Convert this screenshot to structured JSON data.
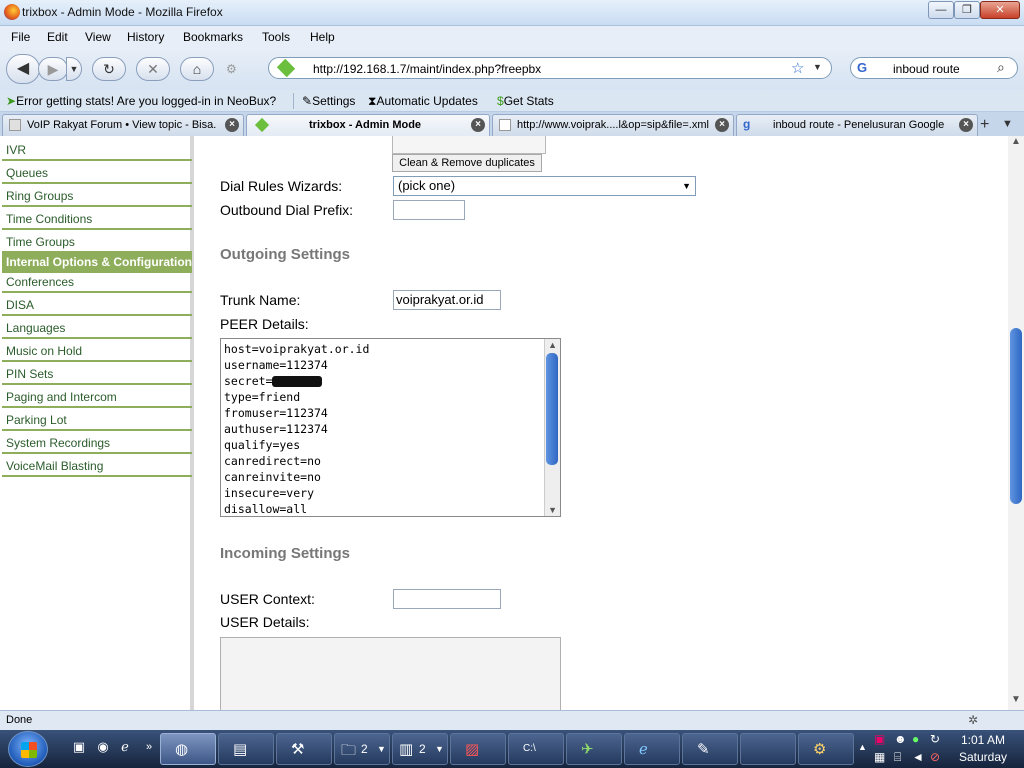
{
  "window": {
    "title": "trixbox - Admin Mode - Mozilla Firefox",
    "min": "—",
    "max": "❐",
    "close": "✕"
  },
  "menu": [
    "File",
    "Edit",
    "View",
    "History",
    "Bookmarks",
    "Tools",
    "Help"
  ],
  "nav": {
    "url": "http://192.168.1.7/maint/index.php?freepbx",
    "search_value": "inboud route"
  },
  "bookmarks": [
    "Error getting stats! Are you logged-in in NeoBux?",
    "Settings",
    "Automatic Updates",
    "Get Stats"
  ],
  "tabs": [
    {
      "label": "VoIP Rakyat Forum • View topic - Bisa...",
      "active": false
    },
    {
      "label": "trixbox - Admin Mode",
      "active": true
    },
    {
      "label": "http://www.voiprak....l&op=sip&file=.xml",
      "active": false
    },
    {
      "label": "inboud route - Penelusuran Google",
      "active": false
    }
  ],
  "sidebar": {
    "items": [
      {
        "label": "IVR"
      },
      {
        "label": "Queues"
      },
      {
        "label": "Ring Groups"
      },
      {
        "label": "Time Conditions"
      },
      {
        "label": "Time Groups"
      },
      {
        "label": "Internal Options & Configuration",
        "active": true
      },
      {
        "label": "Conferences"
      },
      {
        "label": "DISA"
      },
      {
        "label": "Languages"
      },
      {
        "label": "Music on Hold"
      },
      {
        "label": "PIN Sets"
      },
      {
        "label": "Paging and Intercom"
      },
      {
        "label": "Parking Lot"
      },
      {
        "label": "System Recordings"
      },
      {
        "label": "VoiceMail Blasting"
      }
    ]
  },
  "form": {
    "clean_button": "Clean & Remove duplicates",
    "dial_rules_label": "Dial Rules Wizards:",
    "dial_rules_value": "(pick one)",
    "outbound_prefix_label": "Outbound Dial Prefix:",
    "outbound_prefix_value": "",
    "outgoing_section": "Outgoing Settings",
    "trunk_name_label": "Trunk Name:",
    "trunk_name_value": "voiprakyat.or.id",
    "peer_details_label": "PEER Details:",
    "peer_details_lines": [
      "host=voiprakyat.or.id",
      "username=112374",
      "secret=",
      "type=friend",
      "fromuser=112374",
      "authuser=112374",
      "qualify=yes",
      "canredirect=no",
      "canreinvite=no",
      "insecure=very",
      "disallow=all"
    ],
    "incoming_section": "Incoming Settings",
    "user_context_label": "USER Context:",
    "user_context_value": "",
    "user_details_label": "USER Details:"
  },
  "status": {
    "text": "Done"
  },
  "taskbar": {
    "buttons": [
      {
        "icon": "firefox-icon",
        "count": ""
      },
      {
        "icon": "app-icon",
        "count": ""
      },
      {
        "icon": "tool-icon",
        "count": ""
      },
      {
        "icon": "folder-icon",
        "count": "2"
      },
      {
        "icon": "document-icon",
        "count": "2"
      },
      {
        "icon": "pdf-icon",
        "count": ""
      },
      {
        "icon": "cmd-icon",
        "count": ""
      },
      {
        "icon": "satellite-icon",
        "count": ""
      },
      {
        "icon": "ie-icon",
        "count": ""
      },
      {
        "icon": "paint-icon",
        "count": ""
      },
      {
        "icon": "blank-icon",
        "count": ""
      },
      {
        "icon": "wrench-icon",
        "count": ""
      }
    ]
  },
  "clock": {
    "time": "1:01 AM",
    "day": "Saturday"
  }
}
